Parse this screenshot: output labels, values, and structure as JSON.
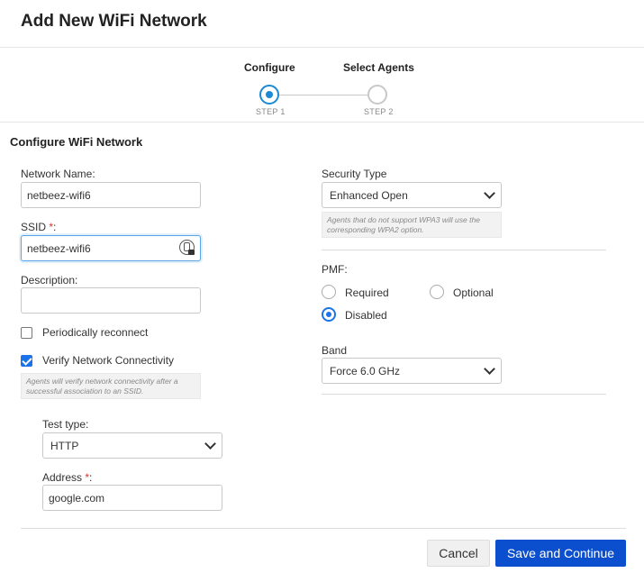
{
  "dialog": {
    "title": "Add New WiFi Network"
  },
  "stepper": {
    "steps": [
      {
        "label": "Configure",
        "sub": "STEP 1"
      },
      {
        "label": "Select Agents",
        "sub": "STEP 2"
      }
    ]
  },
  "section_title": "Configure WiFi Network",
  "form": {
    "network_name": {
      "label": "Network Name:",
      "value": "netbeez-wifi6"
    },
    "ssid": {
      "label": "SSID",
      "required_mark": "*",
      "suffix": ":",
      "value": "netbeez-wifi6"
    },
    "description": {
      "label": "Description:",
      "value": ""
    },
    "periodically_reconnect": {
      "label": "Periodically reconnect",
      "checked": false
    },
    "verify_connectivity": {
      "label": "Verify Network Connectivity",
      "checked": true,
      "hint": "Agents will verify network connectivity after a successful association to an SSID."
    },
    "test_type": {
      "label": "Test type:",
      "value": "HTTP"
    },
    "address": {
      "label": "Address",
      "required_mark": "*",
      "suffix": ":",
      "value": "google.com"
    },
    "security_type": {
      "label": "Security Type",
      "value": "Enhanced Open",
      "hint": "Agents that do not support WPA3 will use the corresponding WPA2 option."
    },
    "pmf": {
      "label": "PMF:",
      "options": [
        "Required",
        "Optional",
        "Disabled"
      ],
      "selected": "Disabled"
    },
    "band": {
      "label": "Band",
      "value": "Force 6.0 GHz"
    }
  },
  "footer": {
    "cancel_label": "Cancel",
    "save_label": "Save and Continue"
  },
  "colors": {
    "primary": "#0b4fcf",
    "accent": "#1a8ad4",
    "required": "#d9342b"
  }
}
